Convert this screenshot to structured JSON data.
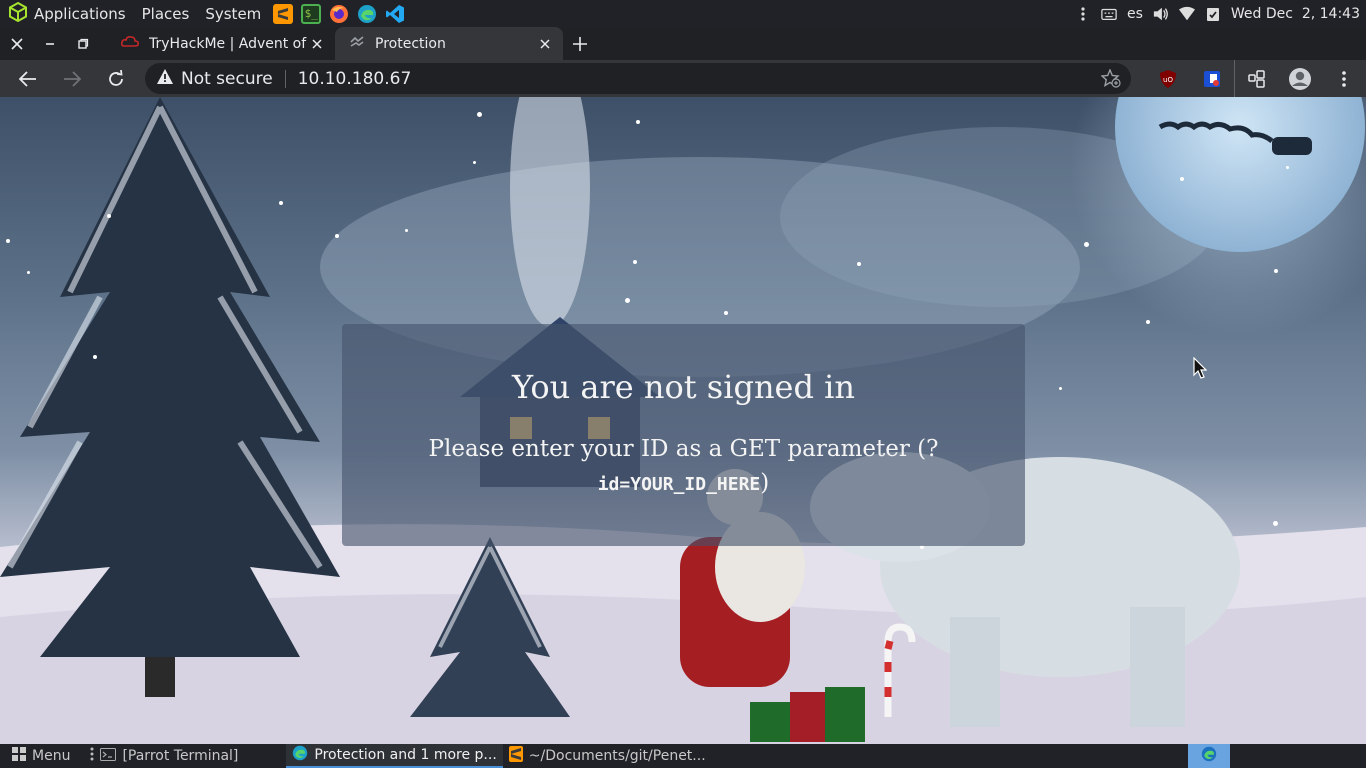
{
  "system_panel": {
    "menus": [
      "Applications",
      "Places",
      "System"
    ],
    "keyboard_layout": "es",
    "clock": "Wed Dec  2, 14:43"
  },
  "browser": {
    "tabs": [
      {
        "title": "TryHackMe | Advent of Cy"
      },
      {
        "title": "Protection"
      }
    ],
    "security_label": "Not secure",
    "url": "10.10.180.67"
  },
  "page": {
    "heading": "You are not signed in",
    "message_prefix": "Please enter your ID as a GET parameter (?",
    "message_code": "id=YOUR_ID_HERE",
    "message_suffix": ")"
  },
  "taskbar": {
    "menu_label": "Menu",
    "tasks": [
      {
        "label": "[Parrot Terminal]"
      },
      {
        "label": "Protection and 1 more p..."
      },
      {
        "label": "~/Documents/git/Penet..."
      }
    ]
  },
  "colors": {
    "panel_bg": "#202227",
    "tabstrip_bg": "#202124",
    "toolbar_bg": "#35363a",
    "accent": "#4a90d9"
  }
}
